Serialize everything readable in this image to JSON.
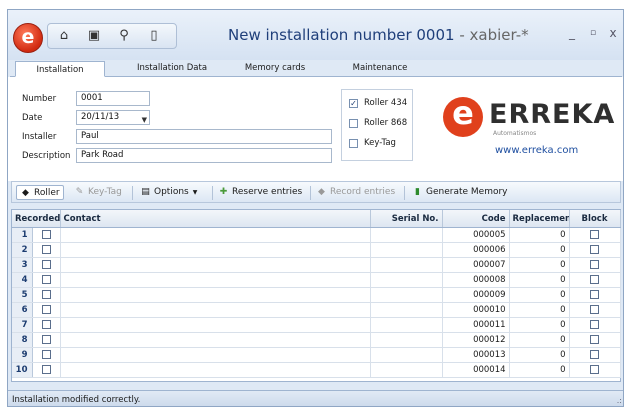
{
  "window": {
    "title": "New installation number 0001",
    "user": " - xabier-*",
    "app_icon": "e-logo-icon",
    "controls": [
      "_",
      "▫",
      "x"
    ]
  },
  "quick_access": [
    {
      "icon": "home-edit-icon",
      "glyph": "⌂"
    },
    {
      "icon": "save-icon",
      "glyph": "▣"
    },
    {
      "icon": "search-icon",
      "glyph": "⚲"
    },
    {
      "icon": "device-icon",
      "glyph": "▯"
    }
  ],
  "tabs": [
    {
      "label": "Installation",
      "active": true
    },
    {
      "label": "Installation Data",
      "active": false
    },
    {
      "label": "Memory cards",
      "active": false
    },
    {
      "label": "Maintenance",
      "active": false
    }
  ],
  "form": {
    "number_label": "Number",
    "number_value": "0001",
    "date_label": "Date",
    "date_value": "20/11/13",
    "installer_label": "Installer",
    "installer_value": "Paul",
    "description_label": "Description",
    "description_value": "Park Road"
  },
  "options": [
    {
      "label": "Roller 434",
      "checked": true
    },
    {
      "label": "Roller 868",
      "checked": false
    },
    {
      "label": "Key-Tag",
      "checked": false
    }
  ],
  "brand": {
    "name": "ERREKA",
    "tagline": "Automatismos",
    "url": "www.erreka.com",
    "color": "#e0401c"
  },
  "toolbar": {
    "roller": "Roller",
    "keytag": "Key-Tag",
    "options": "Options",
    "reserve": "Reserve entries",
    "record": "Record entries",
    "generate": "Generate Memory"
  },
  "grid": {
    "columns": [
      "Recorded",
      "Contact",
      "Serial No.",
      "Code",
      "Replacemen",
      "Block"
    ],
    "rows": [
      {
        "num": "1",
        "code": "000005",
        "replacement": "0"
      },
      {
        "num": "2",
        "code": "000006",
        "replacement": "0"
      },
      {
        "num": "3",
        "code": "000007",
        "replacement": "0"
      },
      {
        "num": "4",
        "code": "000008",
        "replacement": "0"
      },
      {
        "num": "5",
        "code": "000009",
        "replacement": "0"
      },
      {
        "num": "6",
        "code": "000010",
        "replacement": "0"
      },
      {
        "num": "7",
        "code": "000011",
        "replacement": "0"
      },
      {
        "num": "8",
        "code": "000012",
        "replacement": "0"
      },
      {
        "num": "9",
        "code": "000013",
        "replacement": "0"
      },
      {
        "num": "10",
        "code": "000014",
        "replacement": "0"
      }
    ]
  },
  "status": {
    "message": "Installation modified correctly."
  }
}
